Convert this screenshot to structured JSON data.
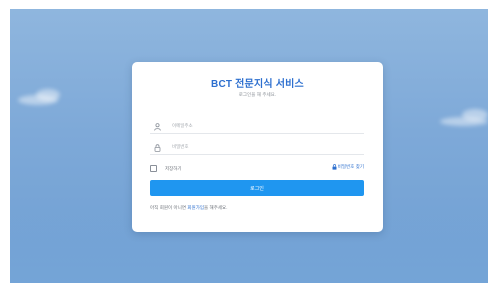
{
  "login": {
    "title": "BCT 전문지식 서비스",
    "subtitle": "로그인을 해 주세요.",
    "email_placeholder": "이메일주소",
    "password_placeholder": "비밀번호",
    "remember_label": "저장하기",
    "find_password_label": "비밀번호 찾기",
    "login_button": "로그인",
    "signup_prefix": "아직 회원이 아니면 ",
    "signup_link": "회원가입",
    "signup_suffix": "을 해주세요."
  },
  "icons": {
    "email": "user-icon",
    "password": "lock-icon",
    "find_password": "lock-icon"
  },
  "colors": {
    "accent": "#1f96f0",
    "title": "#2d6fcf",
    "background": "#7ea9d8"
  }
}
